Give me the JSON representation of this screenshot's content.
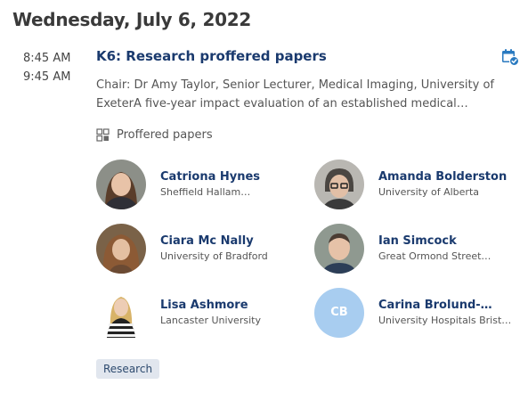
{
  "date_heading": "Wednesday, July 6, 2022",
  "session": {
    "start_time": "8:45 AM",
    "end_time": "9:45 AM",
    "title": "K6: Research proffered papers",
    "description": "Chair: Dr Amy Taylor, Senior Lecturer, Medical Imaging, University of ExeterA five-year impact evaluation of an established medical…",
    "type_label": "Proffered papers",
    "calendar_icon": "calendar-check-icon",
    "accent_color": "#1a3a6e"
  },
  "speakers": [
    {
      "name": "Catriona Hynes",
      "affiliation": "Sheffield Hallam…",
      "initials": ""
    },
    {
      "name": "Amanda Bolderston",
      "affiliation": "University of Alberta",
      "initials": ""
    },
    {
      "name": "Ciara Mc Nally",
      "affiliation": "University of Bradford",
      "initials": ""
    },
    {
      "name": "Ian Simcock",
      "affiliation": "Great Ormond Street…",
      "initials": ""
    },
    {
      "name": "Lisa Ashmore",
      "affiliation": "Lancaster University",
      "initials": ""
    },
    {
      "name": "Carina Brolund-…",
      "affiliation": "University Hospitals Brist…",
      "initials": "CB"
    }
  ],
  "tags": [
    {
      "label": "Research"
    }
  ]
}
